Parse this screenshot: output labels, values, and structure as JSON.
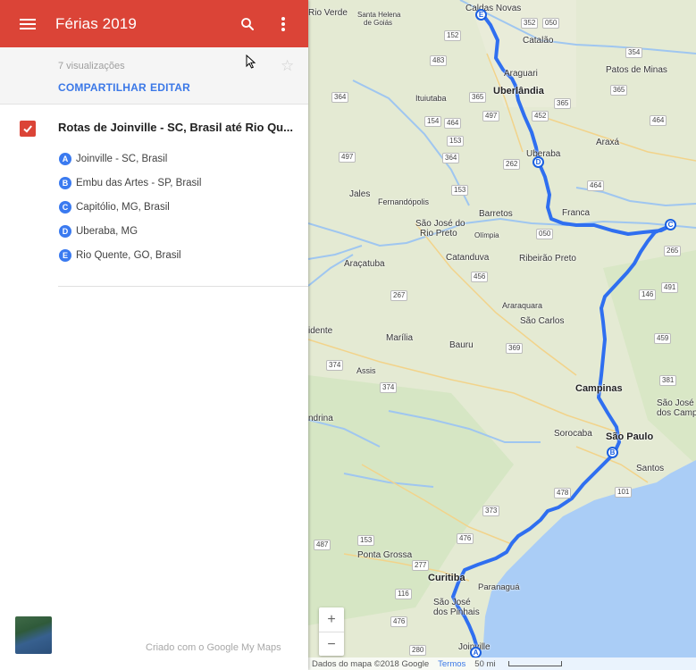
{
  "header": {
    "title": "Férias 2019"
  },
  "details": {
    "views": "7 visualizações",
    "share_label": "COMPARTILHAR",
    "edit_label": "EDITAR"
  },
  "layer": {
    "title": "Rotas de Joinville - SC, Brasil até Rio Qu...",
    "checked": true,
    "stops": [
      {
        "letter": "A",
        "label": "Joinville - SC, Brasil"
      },
      {
        "letter": "B",
        "label": "Embu das Artes - SP, Brasil"
      },
      {
        "letter": "C",
        "label": "Capitólio, MG, Brasil"
      },
      {
        "letter": "D",
        "label": "Uberaba, MG"
      },
      {
        "letter": "E",
        "label": "Rio Quente, GO, Brasil"
      }
    ]
  },
  "footer": {
    "credit": "Criado com o Google My Maps"
  },
  "colors": {
    "header": "#db4437",
    "route": "#3a7af0",
    "link": "#3b78e7"
  },
  "map": {
    "places": {
      "rio_verde": "Rio Verde",
      "santa_helena": "Santa Helena",
      "de_goias": "de Goiás",
      "caldas_novas": "Caldas Novas",
      "catalao": "Catalão",
      "araguari": "Araguari",
      "patos_de_minas": "Patos de Minas",
      "ituiutaba": "Ituiutaba",
      "uberlandia": "Uberlândia",
      "uberaba": "Uberaba",
      "araxa": "Araxá",
      "jales": "Jales",
      "fernandopolis": "Fernandópolis",
      "barretos": "Barretos",
      "franca": "Franca",
      "sao_jose_rio_preto_1": "São José do",
      "sao_jose_rio_preto_2": "Rio Preto",
      "olimpia": "Olímpia",
      "aracatuba": "Araçatuba",
      "catanduva": "Catanduva",
      "ribeirao_preto": "Ribeirão Preto",
      "araraquara": "Araraquara",
      "sao_carlos": "São Carlos",
      "marilia": "Marília",
      "bauru": "Bauru",
      "assis": "Assis",
      "campinas": "Campinas",
      "sorocaba": "Sorocaba",
      "sao_paulo": "São Paulo",
      "sao_jose_campos_1": "São José",
      "sao_jose_campos_2": "dos Camp",
      "santos": "Santos",
      "londrina": "ndrina",
      "presidente": "idente",
      "ponta_grossa": "Ponta Grossa",
      "curitiba": "Curitiba",
      "paranagua": "Paranaguá",
      "sao_jose_pinhais_1": "São José",
      "sao_jose_pinhais_2": "dos Pinhais",
      "joinville": "Joinville"
    },
    "shields": {
      "s352a": "352",
      "s050a": "050",
      "s152": "152",
      "s483": "483",
      "s364a": "364",
      "s365a": "365",
      "s452a": "452",
      "s354": "354",
      "s365b": "365",
      "s154": "154",
      "s464a": "464",
      "s497a": "497",
      "s153a": "153",
      "s262": "262",
      "s364b": "364",
      "s153b": "153",
      "s050b": "050",
      "s464b": "464",
      "s265": "265",
      "s491": "491",
      "s146": "146",
      "s456": "456",
      "s267": "267",
      "s459": "459",
      "s374a": "374",
      "s374b": "374",
      "s369": "369",
      "s381": "381",
      "s478": "478",
      "s101": "101",
      "s373": "373",
      "s476": "476",
      "s487": "487",
      "s153c": "153",
      "s476b": "476",
      "s280": "280",
      "s116": "116",
      "s277": "277",
      "s497b": "497",
      "s365c": "365",
      "s464c": "464"
    },
    "markers": {
      "a": "A",
      "b": "B",
      "c": "C",
      "d": "D",
      "e": "E"
    },
    "zoom_in": "+",
    "zoom_out": "−",
    "attribution": "Dados do mapa ©2018 Google",
    "terms": "Termos",
    "scale": "50 mi"
  }
}
